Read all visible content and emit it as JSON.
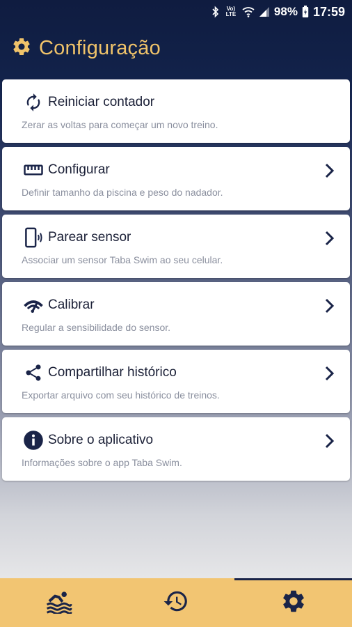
{
  "status_bar": {
    "volte_label": "Vo) LTE",
    "battery_percent": "98%",
    "time": "17:59"
  },
  "header": {
    "title": "Configuração",
    "icon": "gear-icon"
  },
  "settings_items": [
    {
      "icon": "refresh-icon",
      "title": "Reiniciar contador",
      "description": "Zerar as voltas para começar um novo treino.",
      "has_chevron": false
    },
    {
      "icon": "ruler-icon",
      "title": "Configurar",
      "description": "Definir tamanho da piscina e peso do nadador.",
      "has_chevron": true
    },
    {
      "icon": "phone-vibrate-icon",
      "title": "Parear sensor",
      "description": "Associar um sensor Taba Swim ao seu celular.",
      "has_chevron": true
    },
    {
      "icon": "gauge-icon",
      "title": "Calibrar",
      "description": "Regular a sensibilidade do sensor.",
      "has_chevron": true
    },
    {
      "icon": "share-icon",
      "title": "Compartilhar histórico",
      "description": "Exportar arquivo com seu histórico de treinos.",
      "has_chevron": true
    },
    {
      "icon": "info-icon",
      "title": "Sobre o aplicativo",
      "description": "Informações sobre o app Taba Swim.",
      "has_chevron": true
    }
  ],
  "bottom_nav": {
    "items": [
      {
        "icon": "swimmer-icon",
        "active": false
      },
      {
        "icon": "history-icon",
        "active": false
      },
      {
        "icon": "gear-icon",
        "active": true
      }
    ]
  },
  "colors": {
    "header_bg": "#0f1c40",
    "accent_gold": "#f0c36a",
    "nav_bg": "#f2c572",
    "icon_dark": "#1a2448",
    "text_primary": "#1a1f36",
    "text_secondary": "#8a8f9e"
  }
}
